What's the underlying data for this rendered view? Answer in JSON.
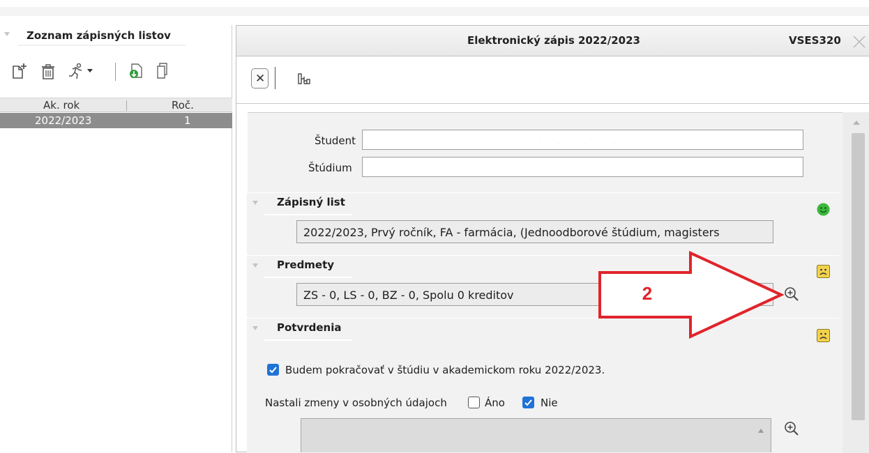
{
  "left_panel": {
    "title": "Zoznam zápisných listov",
    "toolbar_icons": [
      "new-document-icon",
      "trash-icon",
      "runner-icon",
      "dropdown-arrow-icon",
      "import-icon",
      "copy-icon"
    ],
    "columns": [
      "Ak. rok",
      "Roč."
    ],
    "rows": [
      {
        "ak_rok": "2022/2023",
        "roc": "1"
      }
    ]
  },
  "window": {
    "title": "Elektronický zápis 2022/2023",
    "code": "VSES320"
  },
  "form": {
    "student_label": "Študent",
    "student_value": "",
    "studium_label": "Štúdium",
    "studium_value": ""
  },
  "sections": {
    "zapisny_list": {
      "title": "Zápisný list",
      "value": "2022/2023, Prvý ročník, FA - farmácia, (Jednoodborové štúdium, magisters",
      "status_icon": "smiley-happy-icon"
    },
    "predmety": {
      "title": "Predmety",
      "value": "ZS - 0, LS - 0, BZ - 0, Spolu 0 kreditov",
      "status_icon": "smiley-sad-icon"
    },
    "potvrdenia": {
      "title": "Potvrdenia",
      "status_icon": "smiley-sad-icon",
      "continue_text": "Budem pokračovať  v štúdiu v akademickom roku 2022/2023.",
      "continue_checked": true,
      "changes_label": "Nastali zmeny v osobných údajoch",
      "option_ano": "Áno",
      "option_ano_checked": false,
      "option_nie": "Nie",
      "option_nie_checked": true
    }
  },
  "annotation": {
    "label": "2",
    "color": "#e0242b"
  },
  "colors": {
    "selected_row": "#8d8d8d",
    "checkbox": "#1f73d6",
    "smiley_happy": "#3cb83c",
    "smiley_sad": "#f2d24b"
  }
}
